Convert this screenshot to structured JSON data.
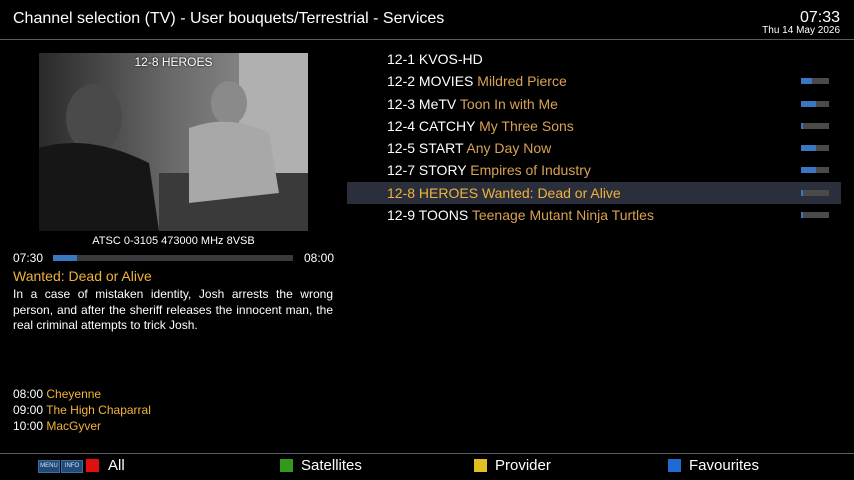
{
  "header": {
    "title": "Channel selection (TV) - User bouquets/Terrestrial - Services",
    "clock": "07:33",
    "date": "Thu 14 May 2026"
  },
  "preview": {
    "channel_label": "12-8 HEROES",
    "tuner_info": "ATSC 0-3105 473000 MHz 8VSB"
  },
  "current_event": {
    "start": "07:30",
    "end": "08:00",
    "progress": 0.1,
    "title": "Wanted: Dead or Alive",
    "description": "In a case of mistaken identity, Josh arrests the wrong person, and after the sheriff releases the innocent man, the real criminal attempts to trick Josh."
  },
  "next_events": [
    {
      "time": "08:00",
      "title": "Cheyenne"
    },
    {
      "time": "09:00",
      "title": "The High Chaparral"
    },
    {
      "time": "10:00",
      "title": "MacGyver"
    }
  ],
  "channels": [
    {
      "number": "12-1",
      "name": "KVOS-HD",
      "program": "",
      "progress": null,
      "selected": false
    },
    {
      "number": "12-2",
      "name": "MOVIES",
      "program": "Mildred Pierce",
      "progress": 0.4,
      "selected": false
    },
    {
      "number": "12-3",
      "name": "MeTV",
      "program": "Toon In with Me",
      "progress": 0.55,
      "selected": false
    },
    {
      "number": "12-4",
      "name": "CATCHY",
      "program": "My Three Sons",
      "progress": 0.08,
      "selected": false
    },
    {
      "number": "12-5",
      "name": "START",
      "program": "Any Day Now",
      "progress": 0.55,
      "selected": false
    },
    {
      "number": "12-7",
      "name": "STORY",
      "program": "Empires of Industry",
      "progress": 0.55,
      "selected": false
    },
    {
      "number": "12-8",
      "name": "HEROES",
      "program": "Wanted: Dead or Alive",
      "progress": 0.08,
      "selected": true
    },
    {
      "number": "12-9",
      "name": "TOONS",
      "program": "Teenage Mutant Ninja Turtles",
      "progress": 0.08,
      "selected": false
    }
  ],
  "footer": {
    "menu_label": "MENU",
    "info_label": "INFO",
    "buttons": [
      {
        "label": "All",
        "color": "#e01010"
      },
      {
        "label": "Satellites",
        "color": "#2f9a1e"
      },
      {
        "label": "Provider",
        "color": "#e0c020"
      },
      {
        "label": "Favourites",
        "color": "#1e6ad0"
      }
    ]
  },
  "colors": {
    "accent": "#f0b23c",
    "program_text": "#d8a255",
    "selection_bg": "#2b2f3b",
    "progress": "#3a77c2"
  }
}
